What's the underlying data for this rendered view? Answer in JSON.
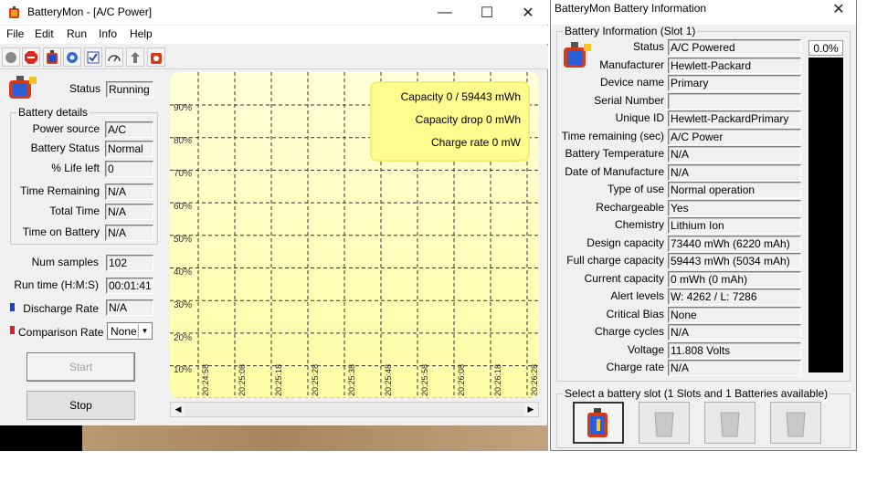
{
  "left_window": {
    "title": "BatteryMon - [A/C Power]",
    "caption": {
      "minimize": "—",
      "maximize": "☐",
      "close": "✕"
    },
    "menu": [
      "File",
      "Edit",
      "Run",
      "Info",
      "Help"
    ],
    "toolbar_icons": [
      "record-icon",
      "stop-icon",
      "battery-icon",
      "gear-icon",
      "checklist-icon",
      "gauge-icon",
      "pointer-icon",
      "battery-settings-icon"
    ],
    "status": {
      "label": "Status",
      "value": "Running"
    },
    "battery_details": {
      "title": "Battery details",
      "rows": [
        {
          "label": "Power source",
          "value": "A/C"
        },
        {
          "label": "Battery Status",
          "value": "Normal"
        },
        {
          "label": "% Life left",
          "value": "0"
        },
        {
          "label": "Time Remaining",
          "value": "N/A"
        },
        {
          "label": "Total Time",
          "value": "N/A"
        },
        {
          "label": "Time on Battery",
          "value": "N/A"
        }
      ]
    },
    "num_samples": {
      "label": "Num samples",
      "value": "102"
    },
    "run_time": {
      "label": "Run time (H:M:S)",
      "value": "00:01:41"
    },
    "discharge_rate": {
      "label": "Discharge Rate",
      "value": "N/A",
      "color": "#1f3fd0"
    },
    "comparison_rate": {
      "label": "Comparison Rate",
      "value": "None",
      "color": "#e02020"
    },
    "start_label": "Start",
    "stop_label": "Stop",
    "chart": {
      "y_ticks": [
        "90%",
        "80%",
        "70%",
        "60%",
        "50%",
        "40%",
        "30%",
        "20%",
        "10%"
      ],
      "x_ticks": [
        "20:24:58",
        "20:25:08",
        "20:25:18",
        "20:25:28",
        "20:25:38",
        "20:25:48",
        "20:25:58",
        "20:26:08",
        "20:26:18",
        "20:26:28"
      ],
      "capacity": "Capacity 0 / 59443 mWh",
      "capacity_drop": "Capacity drop 0 mWh",
      "charge_rate": "Charge rate 0 mW"
    }
  },
  "right_window": {
    "title": "BatteryMon Battery Information",
    "close": "✕",
    "group_title": "Battery Information (Slot 1)",
    "percent": "0.0%",
    "fields": [
      {
        "label": "Status",
        "value": "A/C Powered"
      },
      {
        "label": "Manufacturer",
        "value": "Hewlett-Packard"
      },
      {
        "label": "Device name",
        "value": "Primary"
      },
      {
        "label": "Serial Number",
        "value": ""
      },
      {
        "label": "Unique ID",
        "value": "Hewlett-PackardPrimary"
      },
      {
        "label": "Time remaining (sec)",
        "value": "A/C Power"
      },
      {
        "label": "Battery Temperature",
        "value": "N/A"
      },
      {
        "label": "Date of Manufacture",
        "value": "N/A"
      },
      {
        "label": "Type of use",
        "value": "Normal operation"
      },
      {
        "label": "Rechargeable",
        "value": "Yes"
      },
      {
        "label": "Chemistry",
        "value": "Lithium Ion"
      },
      {
        "label": "Design capacity",
        "value": "73440 mWh (6220 mAh)"
      },
      {
        "label": "Full charge capacity",
        "value": "59443 mWh (5034 mAh)"
      },
      {
        "label": "Current capacity",
        "value": "0 mWh (0 mAh)"
      },
      {
        "label": "Alert levels",
        "value": "W: 4262 / L: 7286"
      },
      {
        "label": "Critical Bias",
        "value": "None"
      },
      {
        "label": "Charge cycles",
        "value": "N/A"
      },
      {
        "label": "Voltage",
        "value": "11.808 Volts"
      },
      {
        "label": "Charge rate",
        "value": "N/A"
      }
    ],
    "slot_group_title": "Select a battery slot (1 Slots and 1 Batteries available)"
  }
}
